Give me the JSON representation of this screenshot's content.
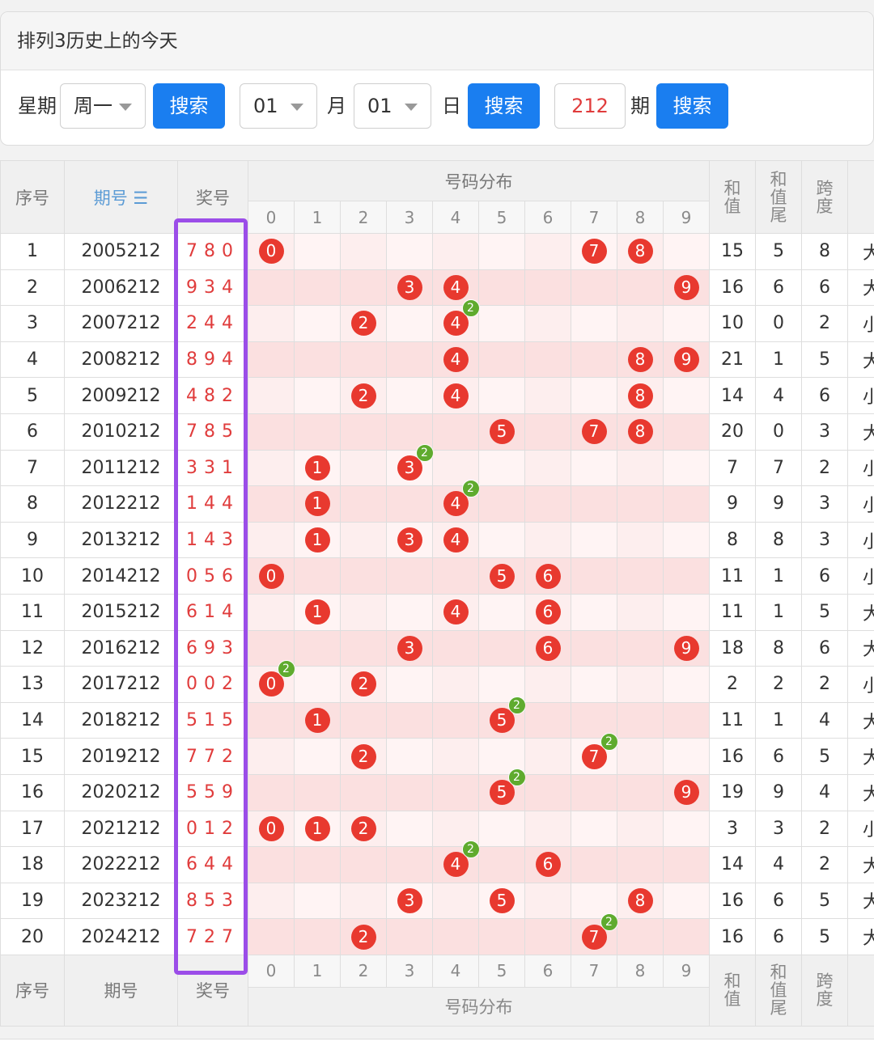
{
  "header": {
    "title": "排列3历史上的今天"
  },
  "controls": {
    "weekday_label": "星期",
    "weekday_value": "周一",
    "search_label": "搜索",
    "month_value": "01",
    "month_label": "月",
    "day_value": "01",
    "day_label": "日",
    "period_value": "212",
    "period_label": "期"
  },
  "table": {
    "headers": {
      "index": "序号",
      "period": "期号",
      "period_sort_icon": "☰",
      "draw": "奖号",
      "distribution": "号码分布",
      "sum": "和值",
      "sum_tail": "和值尾",
      "span": "跨度"
    },
    "digits": [
      "0",
      "1",
      "2",
      "3",
      "4",
      "5",
      "6",
      "7",
      "8",
      "9"
    ],
    "rows": [
      {
        "idx": "1",
        "period": "2005212",
        "draw": "780",
        "sum": "15",
        "tail": "5",
        "span": "8",
        "size": "大"
      },
      {
        "idx": "2",
        "period": "2006212",
        "draw": "934",
        "sum": "16",
        "tail": "6",
        "span": "6",
        "size": "大"
      },
      {
        "idx": "3",
        "period": "2007212",
        "draw": "244",
        "sum": "10",
        "tail": "0",
        "span": "2",
        "size": "小"
      },
      {
        "idx": "4",
        "period": "2008212",
        "draw": "894",
        "sum": "21",
        "tail": "1",
        "span": "5",
        "size": "大"
      },
      {
        "idx": "5",
        "period": "2009212",
        "draw": "482",
        "sum": "14",
        "tail": "4",
        "span": "6",
        "size": "小"
      },
      {
        "idx": "6",
        "period": "2010212",
        "draw": "785",
        "sum": "20",
        "tail": "0",
        "span": "3",
        "size": "大"
      },
      {
        "idx": "7",
        "period": "2011212",
        "draw": "331",
        "sum": "7",
        "tail": "7",
        "span": "2",
        "size": "小"
      },
      {
        "idx": "8",
        "period": "2012212",
        "draw": "144",
        "sum": "9",
        "tail": "9",
        "span": "3",
        "size": "小"
      },
      {
        "idx": "9",
        "period": "2013212",
        "draw": "143",
        "sum": "8",
        "tail": "8",
        "span": "3",
        "size": "小"
      },
      {
        "idx": "10",
        "period": "2014212",
        "draw": "056",
        "sum": "11",
        "tail": "1",
        "span": "6",
        "size": "小"
      },
      {
        "idx": "11",
        "period": "2015212",
        "draw": "614",
        "sum": "11",
        "tail": "1",
        "span": "5",
        "size": "大"
      },
      {
        "idx": "12",
        "period": "2016212",
        "draw": "693",
        "sum": "18",
        "tail": "8",
        "span": "6",
        "size": "大"
      },
      {
        "idx": "13",
        "period": "2017212",
        "draw": "002",
        "sum": "2",
        "tail": "2",
        "span": "2",
        "size": "小"
      },
      {
        "idx": "14",
        "period": "2018212",
        "draw": "515",
        "sum": "11",
        "tail": "1",
        "span": "4",
        "size": "大"
      },
      {
        "idx": "15",
        "period": "2019212",
        "draw": "772",
        "sum": "16",
        "tail": "6",
        "span": "5",
        "size": "大"
      },
      {
        "idx": "16",
        "period": "2020212",
        "draw": "559",
        "sum": "19",
        "tail": "9",
        "span": "4",
        "size": "大"
      },
      {
        "idx": "17",
        "period": "2021212",
        "draw": "012",
        "sum": "3",
        "tail": "3",
        "span": "2",
        "size": "小"
      },
      {
        "idx": "18",
        "period": "2022212",
        "draw": "644",
        "sum": "14",
        "tail": "4",
        "span": "2",
        "size": "大"
      },
      {
        "idx": "19",
        "period": "2023212",
        "draw": "853",
        "sum": "16",
        "tail": "6",
        "span": "5",
        "size": "大"
      },
      {
        "idx": "20",
        "period": "2024212",
        "draw": "727",
        "sum": "16",
        "tail": "6",
        "span": "5",
        "size": "大"
      }
    ]
  },
  "colors": {
    "accent": "#1a7ef0",
    "ball": "#e8392f",
    "repeat_badge": "#5fab2e",
    "highlight": "#9b4de8"
  }
}
